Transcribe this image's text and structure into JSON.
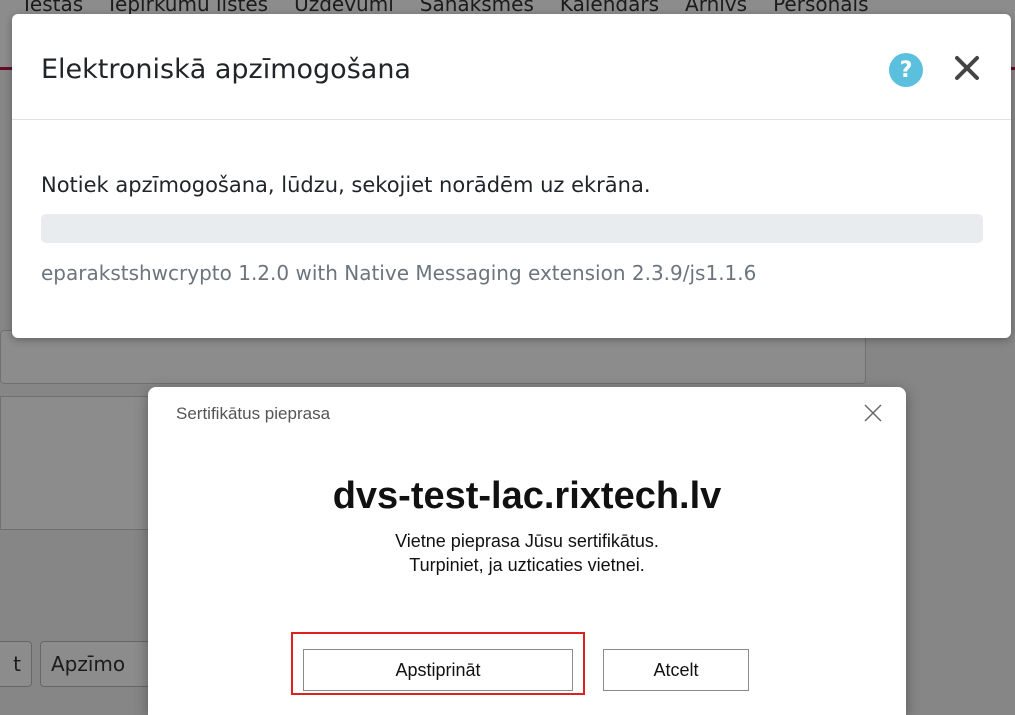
{
  "background": {
    "nav_items": [
      "Iestas",
      "Iepirkumu listes",
      "Uzdevumi",
      "Sanāksmes",
      "Kalendārs",
      "Arhīvs",
      "Personāls"
    ],
    "button_partial_1": "t",
    "button_partial_2": "Apzīmo"
  },
  "modal": {
    "title": "Elektroniskā apzīmogošana",
    "help_glyph": "?",
    "message": "Notiek apzīmogošana, lūdzu, sekojiet norādēm uz ekrāna.",
    "progress": 0,
    "version_text": "eparakstshwcrypto 1.2.0 with Native Messaging extension 2.3.9/js1.1.6"
  },
  "cert_dialog": {
    "title": "Sertifikātus pieprasa",
    "domain": "dvs-test-lac.rixtech.lv",
    "line1": "Vietne pieprasa Jūsu sertifikātus.",
    "line2": "Turpiniet, ja uzticaties vietnei.",
    "confirm_label": "Apstiprināt",
    "cancel_label": "Atcelt"
  },
  "colors": {
    "accent": "#c0144c",
    "help_icon": "#5bc0de",
    "focus_frame": "#e02020"
  }
}
